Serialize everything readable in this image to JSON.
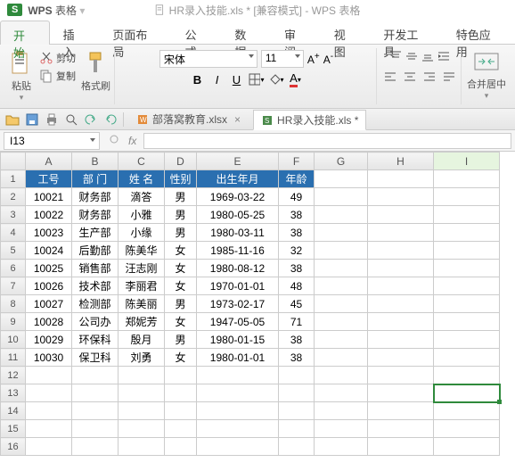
{
  "app": {
    "logo_text": "S",
    "brand": "WPS",
    "apptitle": "表格",
    "doc_title": "HR录入技能.xls * [兼容模式] - WPS 表格"
  },
  "menu": {
    "tabs": [
      "开始",
      "插入",
      "页面布局",
      "公式",
      "数据",
      "审阅",
      "视图",
      "开发工具",
      "特色应用"
    ],
    "active": 0
  },
  "ribbon": {
    "paste": "粘贴",
    "cut": "剪切",
    "copy": "复制",
    "formatpainter": "格式刷",
    "font_name": "宋体",
    "font_size": "11",
    "merge": "合并居中"
  },
  "doc_tabs": [
    {
      "label": "部落窝教育.xlsx",
      "active": false
    },
    {
      "label": "HR录入技能.xls *",
      "active": true
    }
  ],
  "cellref": {
    "name": "I13"
  },
  "grid": {
    "columns": [
      "A",
      "B",
      "C",
      "D",
      "E",
      "F",
      "G",
      "H",
      "I"
    ],
    "header": [
      "工号",
      "部 门",
      "姓 名",
      "性别",
      "出生年月",
      "年龄"
    ],
    "rows": [
      [
        "10021",
        "财务部",
        "滴答",
        "男",
        "1969-03-22",
        "49"
      ],
      [
        "10022",
        "财务部",
        "小雅",
        "男",
        "1980-05-25",
        "38"
      ],
      [
        "10023",
        "生产部",
        "小缘",
        "男",
        "1980-03-11",
        "38"
      ],
      [
        "10024",
        "后勤部",
        "陈美华",
        "女",
        "1985-11-16",
        "32"
      ],
      [
        "10025",
        "销售部",
        "汪志刚",
        "女",
        "1980-08-12",
        "38"
      ],
      [
        "10026",
        "技术部",
        "李丽君",
        "女",
        "1970-01-01",
        "48"
      ],
      [
        "10027",
        "检测部",
        "陈美丽",
        "男",
        "1973-02-17",
        "45"
      ],
      [
        "10028",
        "公司办",
        "郑妮芳",
        "女",
        "1947-05-05",
        "71"
      ],
      [
        "10029",
        "环保科",
        "殷月",
        "男",
        "1980-01-15",
        "38"
      ],
      [
        "10030",
        "保卫科",
        "刘勇",
        "女",
        "1980-01-01",
        "38"
      ]
    ],
    "selected": {
      "col": "I",
      "row": 13
    },
    "total_rows_visible": 16
  }
}
